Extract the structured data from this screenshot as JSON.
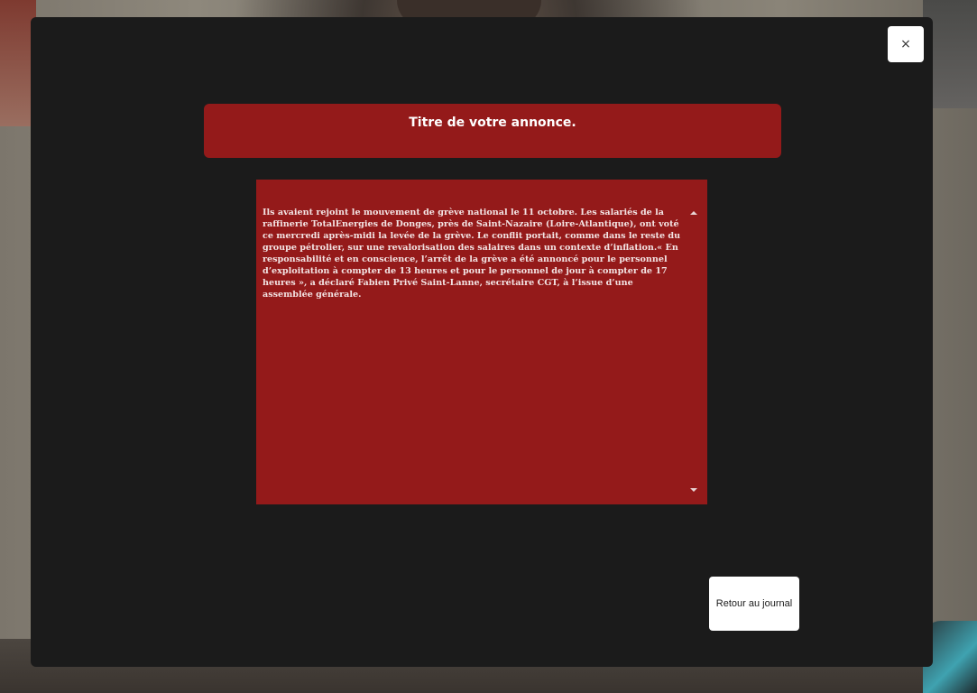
{
  "dialog": {
    "close_label": "×",
    "title": "Titre de votre annonce.",
    "body": "Ils avaient rejoint le mouvement de grève national le 11 octobre. Les salariés de la raffinerie TotalEnergies de Donges, près de Saint-Nazaire (Loire-Atlantique), ont voté ce mercredi après-midi la levée de la grève. Le conflit portait, comme dans le reste du groupe pétrolier, sur une revalorisation des salaires dans un contexte d’inflation.« En responsabilité et en conscience, l’arrêt de la grève a été annoncé pour le personnel d’exploitation à compter de 13 heures et pour le personnel de jour à compter de 17 heures », a déclaré Fabien Privé Saint-Lanne, secrétaire CGT, à l’issue d’une assemblée générale.",
    "back_button_label": "Retour au journal"
  },
  "icons": {
    "close": "close-icon",
    "scroll_up": "chevron-up-icon",
    "scroll_down": "chevron-down-icon"
  },
  "colors": {
    "modal_background": "#1b1b1b",
    "accent_red": "#941a1a",
    "button_background": "#ffffff"
  }
}
